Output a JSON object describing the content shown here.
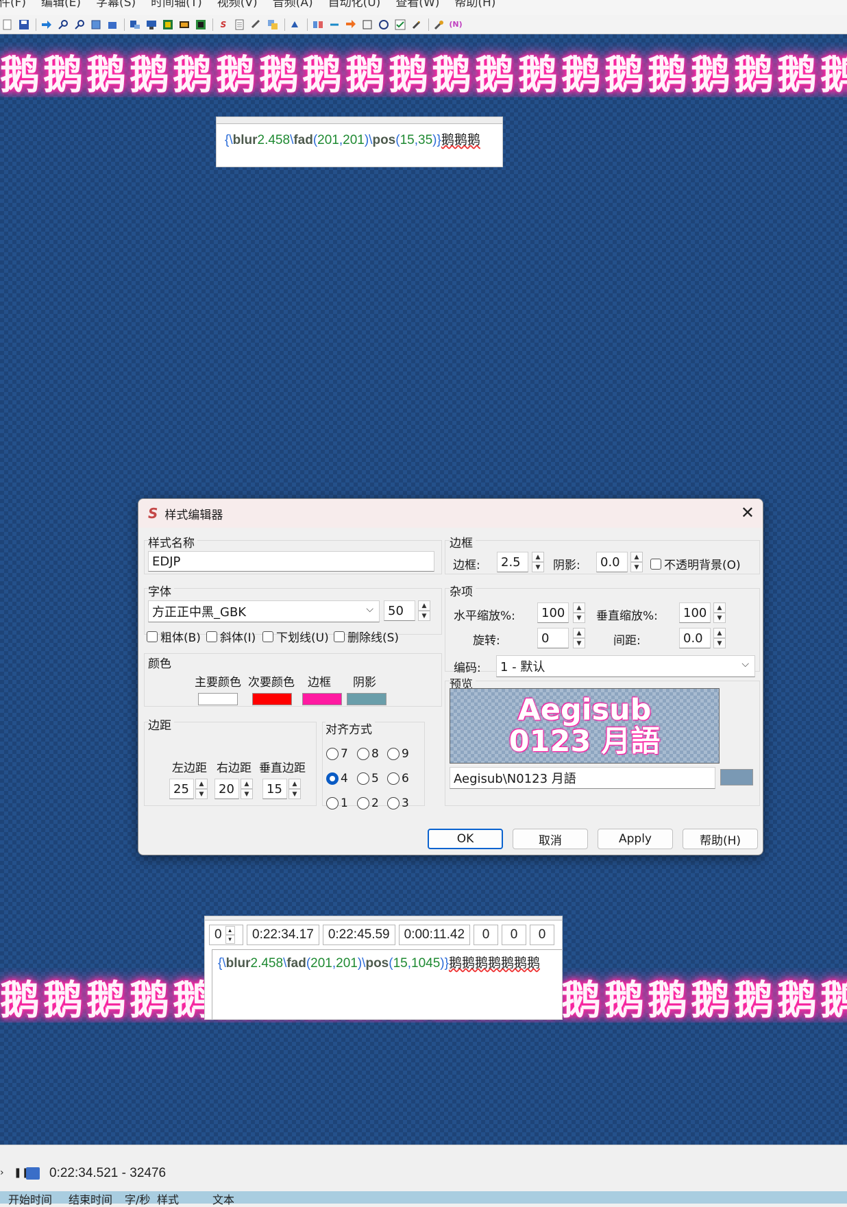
{
  "menu": [
    "件(F)",
    "编辑(E)",
    "字幕(S)",
    "时间轴(T)",
    "视频(V)",
    "音频(A)",
    "自动化(U)",
    "查看(W)",
    "帮助(H)"
  ],
  "toolbar": {
    "icons": [
      "new-file-icon",
      "save-icon",
      "jump-icon",
      "zoom-in-icon",
      "zoom-out-icon",
      "properties-icon",
      "attachments-icon",
      "styles-manager-icon",
      "fonts-collector-icon",
      "resample-icon",
      "export-icon",
      "aegisub-icon",
      "notes-icon",
      "tag-icon",
      "link-icon",
      "translate-icon",
      "spell-icon",
      "shift-icon",
      "snap-icon",
      "timing-icon",
      "clock-icon",
      "recent-icon",
      "check-icon",
      "tools-icon",
      "automation-icon"
    ]
  },
  "video": {
    "neon_text": "鹅鹅鹅鹅鹅鹅鹅鹅鹅鹅鹅鹅鹅鹅鹅鹅鹅鹅鹅鹅",
    "top_edit": {
      "line": {
        "t1": "blur",
        "v1": "2.458",
        "t2": "fad",
        "v2a": "201",
        "v2b": "201",
        "t3": "pos",
        "v3a": "15",
        "v3b": "35",
        "text": "鹅鹅鹅"
      }
    },
    "bottom_edit": {
      "layer": "0",
      "start": "0:22:34.17",
      "end": "0:22:45.59",
      "duration": "0:00:11.42",
      "margin_l": "0",
      "margin_r": "0",
      "margin_v": "0",
      "line": {
        "t1": "blur",
        "v1": "2.458",
        "t2": "fad",
        "v2a": "201",
        "v2b": "201",
        "t3": "pos",
        "v3a": "15",
        "v3b": "1045",
        "text": "鹅鹅鹅鹅鹅鹅鹅"
      }
    }
  },
  "dialog": {
    "title": "样式编辑器",
    "close": "✕",
    "style_name_label": "样式名称",
    "style_name": "EDJP",
    "font_label": "字体",
    "font_name": "方正正中黑_GBK",
    "font_size": "50",
    "bold": "粗体(B)",
    "italic": "斜体(I)",
    "underline": "下划线(U)",
    "strikeout": "删除线(S)",
    "colors_label": "颜色",
    "colors": [
      {
        "label": "主要颜色",
        "color": "#ffffff"
      },
      {
        "label": "次要颜色",
        "color": "#ff0000"
      },
      {
        "label": "边框",
        "color": "#ff1aa1"
      },
      {
        "label": "阴影",
        "color": "#6a9eaa"
      }
    ],
    "margins_label": "边距",
    "margin_left_label": "左边距",
    "margin_right_label": "右边距",
    "margin_vert_label": "垂直边距",
    "margin_left": "25",
    "margin_right": "20",
    "margin_vert": "15",
    "align_label": "对齐方式",
    "align_options": [
      "7",
      "8",
      "9",
      "4",
      "5",
      "6",
      "1",
      "2",
      "3"
    ],
    "align_selected": "4",
    "border_group_label": "边框",
    "outline_label": "边框:",
    "outline": "2.5",
    "shadow_label": "阴影:",
    "shadow": "0.0",
    "opaque_box": "不透明背景(O)",
    "misc_label": "杂项",
    "scale_x_label": "水平缩放%:",
    "scale_x": "100",
    "scale_y_label": "垂直缩放%:",
    "scale_y": "100",
    "angle_label": "旋转:",
    "angle": "0",
    "spacing_label": "间距:",
    "spacing": "0.0",
    "encoding_label": "编码:",
    "encoding": "1 - 默认",
    "preview_label": "预览",
    "preview_line1": "Aegisub",
    "preview_line2": "0123 月語",
    "preview_text": "Aegisub\\N0123 月語",
    "preview_bg_color": "#7a99b4",
    "buttons": {
      "ok": "OK",
      "cancel": "取消",
      "apply": "Apply",
      "help": "帮助(H)"
    }
  },
  "status": {
    "timecode": "0:22:34.521 - 32476",
    "columns": [
      "开始时间",
      "结束时间",
      "字/秒",
      "样式",
      "文本"
    ]
  }
}
